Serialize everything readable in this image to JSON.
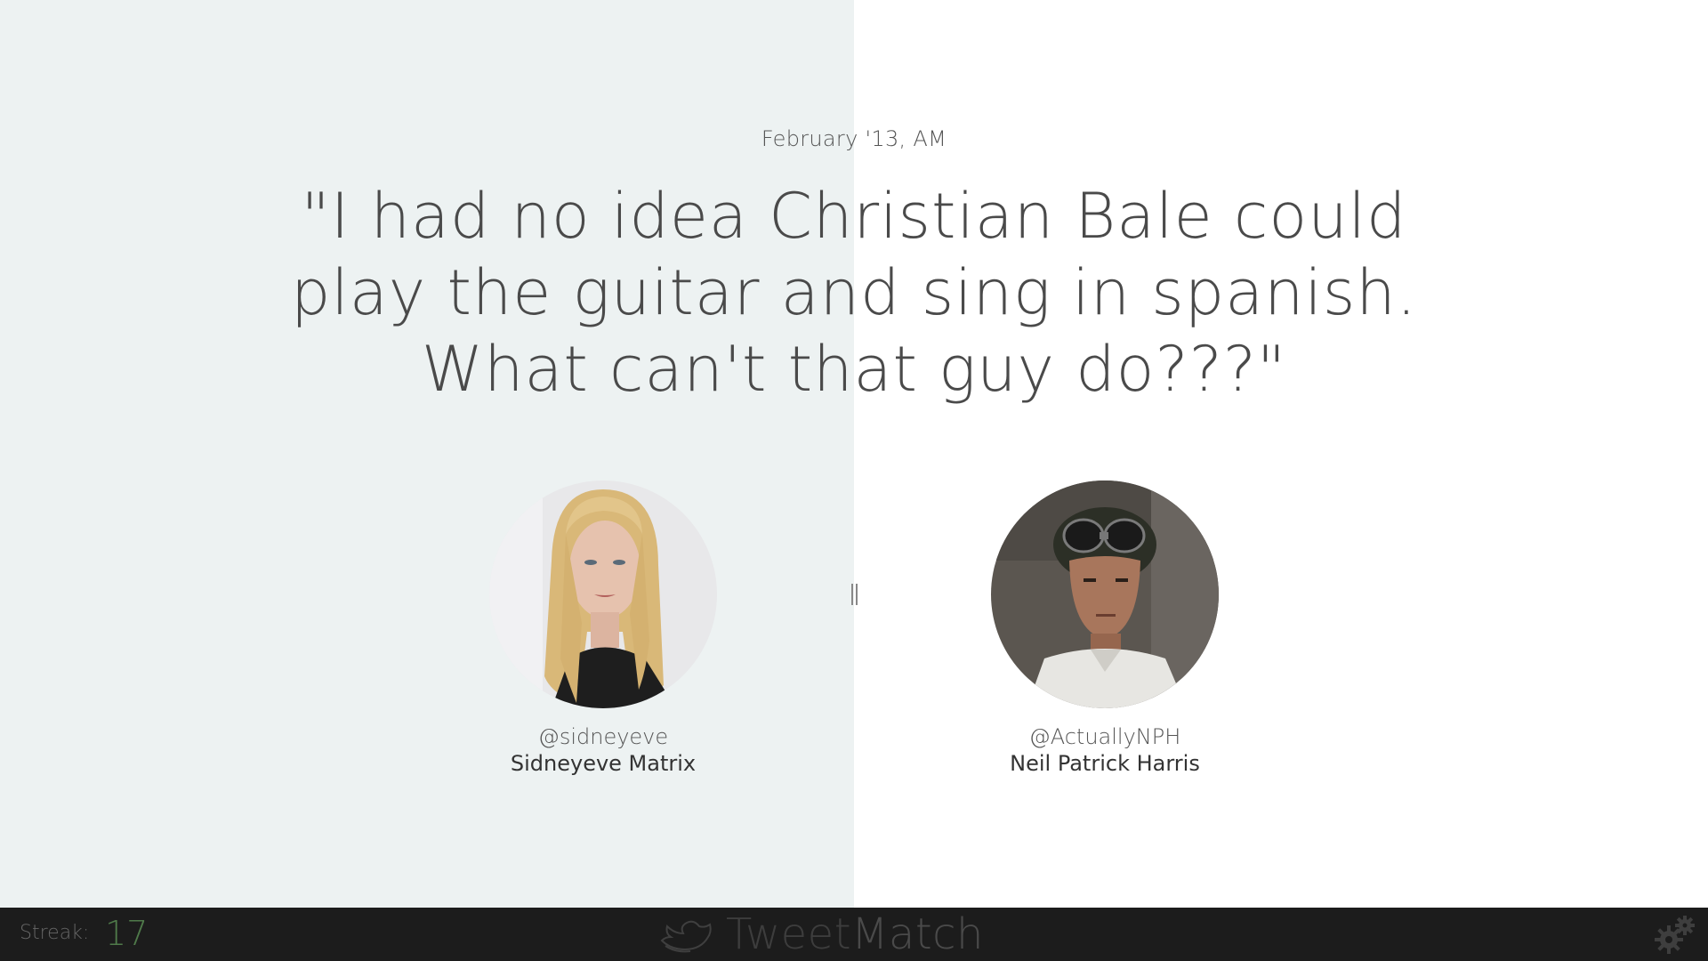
{
  "tweet": {
    "date": "February '13, AM",
    "text": "\"I had no idea Christian Bale could play the guitar and sing in spanish. What can't that guy do???\""
  },
  "candidates": [
    {
      "handle": "@sidneyeve",
      "name": "Sidneyeve Matrix"
    },
    {
      "handle": "@ActuallyNPH",
      "name": "Neil Patrick Harris"
    }
  ],
  "divider_icon": "divider-bars-icon",
  "footer": {
    "streak_label": "Streak:",
    "streak_value": "17",
    "brand_light": "Tweet",
    "brand_strong": "Match",
    "logo_icon": "bird-logo-icon",
    "settings_icon": "gear-icon"
  },
  "colors": {
    "left_panel": "#edf2f2",
    "right_panel": "#ffffff",
    "footer_bg": "#1c1c1c",
    "streak_value": "#4f7a4a"
  }
}
